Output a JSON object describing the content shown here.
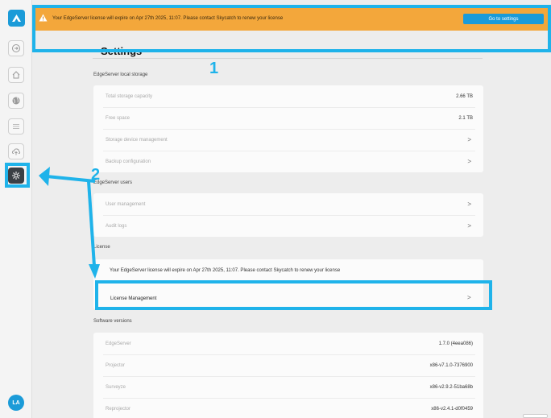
{
  "banner": {
    "message": "Your EdgeServer license will expire on Apr 27th 2025, 11:07. Please contact Skycatch to renew your license",
    "button_label": "Go to settings"
  },
  "page": {
    "title": "Settings"
  },
  "storage": {
    "heading": "EdgeServer local storage",
    "rows": [
      {
        "label": "Total storage capacity",
        "value": "2.66 TB"
      },
      {
        "label": "Free space",
        "value": "2.1 TB"
      },
      {
        "label": "Storage device management",
        "value": ">"
      },
      {
        "label": "Backup configuration",
        "value": ">"
      }
    ]
  },
  "users": {
    "heading": "EdgeServer users",
    "rows": [
      {
        "label": "User management",
        "value": ">"
      },
      {
        "label": "Audit logs",
        "value": ">"
      }
    ]
  },
  "license": {
    "heading": "License",
    "message": "Your EdgeServer license will expire on Apr 27th 2025, 11:07. Please contact Skycatch to renew your license",
    "management_label": "License Management",
    "management_chevron": ">"
  },
  "software": {
    "heading": "Software versions",
    "rows": [
      {
        "label": "EdgeServer",
        "value": "1.7.0 (4eea086)"
      },
      {
        "label": "Projector",
        "value": "x86-v7.1.0-7376900"
      },
      {
        "label": "Surveyze",
        "value": "x86-v2.9.2-51ba68b"
      },
      {
        "label": "Reprojector",
        "value": "x86-v2.4.1-d0f0459"
      }
    ]
  },
  "annotations": {
    "step1": "1",
    "step2": "2"
  },
  "user": {
    "initials": "LA"
  },
  "colors": {
    "accent": "#1b9bd8",
    "banner": "#f3a73b",
    "highlight": "#1fb3ea"
  },
  "icons": [
    "skycatch-logo-icon",
    "circle-arrow-icon",
    "home-icon",
    "globe-icon",
    "list-icon",
    "cloud-upload-icon",
    "gear-icon",
    "warning-icon"
  ]
}
